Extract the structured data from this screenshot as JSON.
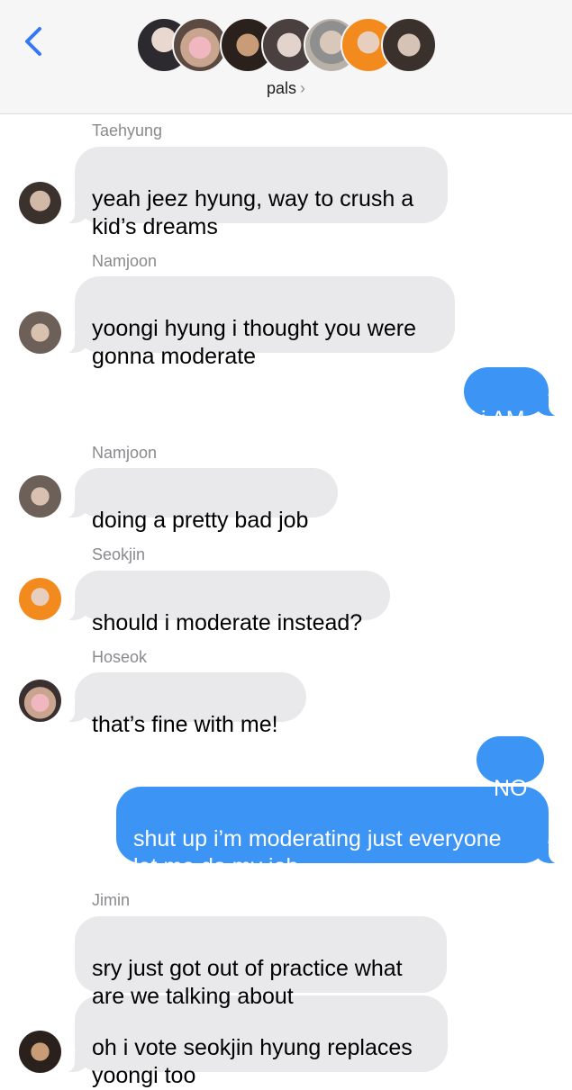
{
  "header": {
    "group_name": "pals",
    "chevron": "›",
    "back_icon": "chevron-left-icon",
    "accent": "#3478f6"
  },
  "messages": [
    {
      "sender": "Taehyung",
      "text": "yeah jeez hyung, way to crush a\nkid’s dreams",
      "outgoing": false
    },
    {
      "sender": "Namjoon",
      "text": "yoongi hyung i thought you were\ngonna moderate",
      "outgoing": false
    },
    {
      "sender": "",
      "text": "i AM",
      "outgoing": true
    },
    {
      "sender": "Namjoon",
      "text": "doing a pretty bad job",
      "outgoing": false
    },
    {
      "sender": "Seokjin",
      "text": "should i moderate instead?",
      "outgoing": false
    },
    {
      "sender": "Hoseok",
      "text": "that’s fine with me!",
      "outgoing": false
    },
    {
      "sender": "",
      "text": "NO",
      "outgoing": true
    },
    {
      "sender": "",
      "text": "shut up i’m moderating just everyone\nlet me do my job",
      "outgoing": true
    },
    {
      "sender": "Jimin",
      "text": "sry just got out of practice what\nare we talking about",
      "outgoing": false
    },
    {
      "sender": "",
      "text": "oh i vote seokjin hyung replaces\nyoongi too",
      "outgoing": false
    }
  ],
  "colors": {
    "incoming_bubble": "#e9e9eb",
    "outgoing_bubble": "#3c94f5",
    "sender_name": "#8a8a8e"
  }
}
